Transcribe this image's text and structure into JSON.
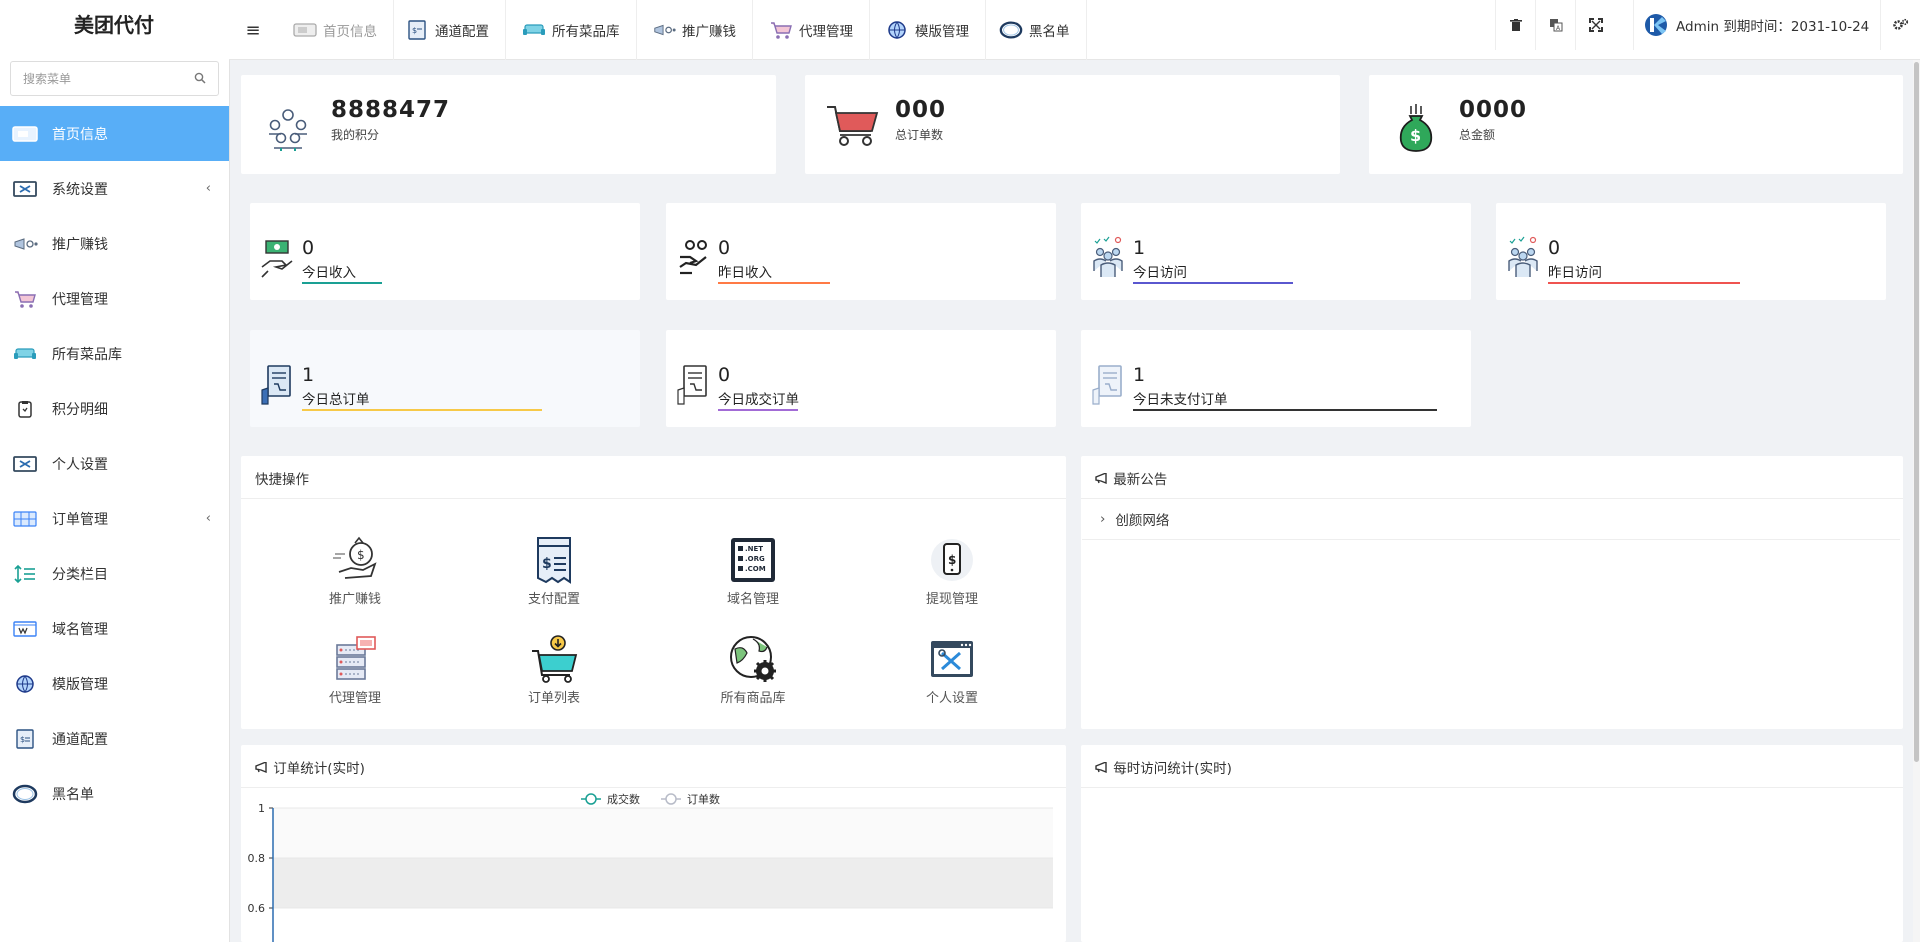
{
  "app": {
    "title": "美团代付"
  },
  "sidebar": {
    "search_placeholder": "搜索菜单",
    "items": [
      {
        "label": "首页信息",
        "icon": "monitor-icon",
        "active": true
      },
      {
        "label": "系统设置",
        "icon": "tools-icon",
        "has_submenu": true
      },
      {
        "label": "推广赚钱",
        "icon": "megaphone-icon"
      },
      {
        "label": "代理管理",
        "icon": "cart-icon"
      },
      {
        "label": "所有菜品库",
        "icon": "sofa-icon"
      },
      {
        "label": "积分明细",
        "icon": "clipboard-icon"
      },
      {
        "label": "个人设置",
        "icon": "tools-icon"
      },
      {
        "label": "订单管理",
        "icon": "grid-icon",
        "has_submenu": true
      },
      {
        "label": "分类栏目",
        "icon": "sort-icon"
      },
      {
        "label": "域名管理",
        "icon": "www-icon"
      },
      {
        "label": "模版管理",
        "icon": "globe-icon"
      },
      {
        "label": "通道配置",
        "icon": "payment-icon"
      },
      {
        "label": "黑名单",
        "icon": "ring-icon"
      }
    ]
  },
  "topnav": {
    "tabs": [
      {
        "label": "首页信息",
        "icon": "monitor-icon",
        "dim": true
      },
      {
        "label": "通道配置",
        "icon": "payment-icon"
      },
      {
        "label": "所有菜品库",
        "icon": "sofa-icon"
      },
      {
        "label": "推广赚钱",
        "icon": "megaphone-icon"
      },
      {
        "label": "代理管理",
        "icon": "cart-icon"
      },
      {
        "label": "模版管理",
        "icon": "globe-icon"
      },
      {
        "label": "黑名单",
        "icon": "ring-icon"
      }
    ],
    "user_text": "Admin 到期时间：2031-10-24"
  },
  "stats_top": [
    {
      "value": "8888477",
      "label": "我的积分",
      "icon": "team-icon"
    },
    {
      "value": "000",
      "label": "总订单数",
      "icon": "shopping-cart-icon"
    },
    {
      "value": "0000",
      "label": "总金额",
      "icon": "money-bag-icon"
    }
  ],
  "stats_mid": [
    {
      "value": "0",
      "label": "今日收入",
      "icon": "cash-hand-icon",
      "bar_color": "#1aa094",
      "bar_fraction": 0.25
    },
    {
      "value": "0",
      "label": "昨日收入",
      "icon": "coins-hand-icon",
      "bar_color": "#ff7a45",
      "bar_fraction": 0.35
    },
    {
      "value": "1",
      "label": "今日访问",
      "icon": "visitors-icon",
      "bar_color": "#5a57cf",
      "bar_fraction": 0.5
    },
    {
      "value": "0",
      "label": "昨日访问",
      "icon": "visitors-icon",
      "bar_color": "#ef5350",
      "bar_fraction": 0.6
    },
    {
      "value": "1",
      "label": "今日总订单",
      "icon": "order-list-icon",
      "bar_color": "#f7c948",
      "bar_fraction": 0.75
    },
    {
      "value": "0",
      "label": "今日成交订单",
      "icon": "order-done-icon",
      "bar_color": "#a26bd6",
      "bar_fraction": 0.25
    },
    {
      "value": "1",
      "label": "今日未支付订单",
      "icon": "order-unpaid-icon",
      "bar_color": "#333333",
      "bar_fraction": 0.95
    }
  ],
  "quick_actions": {
    "title": "快捷操作",
    "items": [
      {
        "label": "推广赚钱",
        "icon": "money-hand-icon"
      },
      {
        "label": "支付配置",
        "icon": "bill-icon"
      },
      {
        "label": "域名管理",
        "icon": "domain-net-icon"
      },
      {
        "label": "提现管理",
        "icon": "phone-cash-icon"
      },
      {
        "label": "代理管理",
        "icon": "server-icon"
      },
      {
        "label": "订单列表",
        "icon": "cart-download-icon"
      },
      {
        "label": "所有商品库",
        "icon": "globe-gear-icon"
      },
      {
        "label": "个人设置",
        "icon": "browser-tools-icon"
      }
    ]
  },
  "notices": {
    "title": "最新公告",
    "items": [
      {
        "label": "创颜网络"
      }
    ]
  },
  "order_stats": {
    "title": "订单统计(实时)"
  },
  "visit_stats": {
    "title": "每时访问统计(实时)"
  },
  "chart_data": {
    "type": "line",
    "series": [
      {
        "name": "成交数",
        "color": "#1aa094",
        "values": []
      },
      {
        "name": "订单数",
        "color": "#b8bcc8",
        "values": []
      }
    ],
    "yticks": [
      "1",
      "0.8",
      "0.6"
    ],
    "ylim": [
      0.6,
      1
    ],
    "grid": true,
    "legend": "top-center"
  },
  "colors": {
    "accent": "#58aef7",
    "background": "#f0f2f5"
  }
}
